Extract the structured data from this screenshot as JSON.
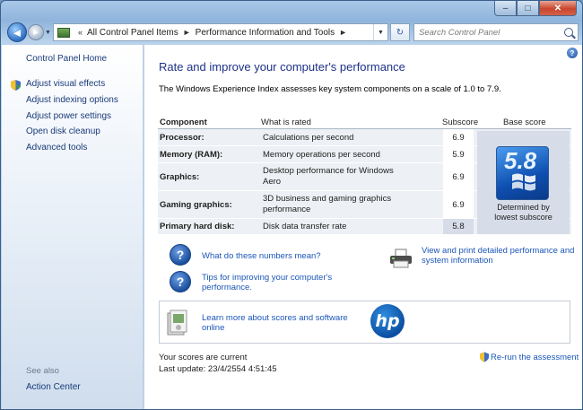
{
  "window": {
    "caption_buttons": [
      "–",
      "□",
      "✕"
    ]
  },
  "nav": {
    "back_glyph": "◄",
    "forward_glyph": "►",
    "breadcrumb": [
      "All Control Panel Items",
      "Performance Information and Tools"
    ],
    "search_placeholder": "Search Control Panel",
    "refresh_glyph": "↻"
  },
  "sidebar": {
    "home": "Control Panel Home",
    "items": [
      {
        "label": "Adjust visual effects",
        "shield": true
      },
      {
        "label": "Adjust indexing options",
        "shield": false
      },
      {
        "label": "Adjust power settings",
        "shield": false
      },
      {
        "label": "Open disk cleanup",
        "shield": false
      },
      {
        "label": "Advanced tools",
        "shield": false
      }
    ],
    "see_also_title": "See also",
    "see_also": [
      "Action Center"
    ]
  },
  "main": {
    "help_glyph": "?",
    "title": "Rate and improve your computer's performance",
    "intro": "The Windows Experience Index assesses key system components on a scale of 1.0 to 7.9.",
    "table": {
      "headers": {
        "component": "Component",
        "rated": "What is rated",
        "subscore": "Subscore",
        "base": "Base score"
      },
      "rows": [
        {
          "component": "Processor:",
          "rated": "Calculations per second",
          "subscore": "6.9"
        },
        {
          "component": "Memory (RAM):",
          "rated": "Memory operations per second",
          "subscore": "5.9"
        },
        {
          "component": "Graphics:",
          "rated": "Desktop performance for Windows Aero",
          "subscore": "6.9"
        },
        {
          "component": "Gaming graphics:",
          "rated": "3D business and gaming graphics performance",
          "subscore": "6.9"
        },
        {
          "component": "Primary hard disk:",
          "rated": "Disk data transfer rate",
          "subscore": "5.8"
        }
      ],
      "base_score": "5.8",
      "base_caption_1": "Determined by",
      "base_caption_2": "lowest subscore"
    },
    "links": {
      "numbers_meaning": "What do these numbers mean?",
      "tips_line1": "Tips for improving your computer's",
      "tips_line2": "performance.",
      "print_line1": "View and print detailed performance and",
      "print_line2": "system information",
      "learn_line1": "Learn more about scores and software",
      "learn_line2": "online",
      "rerun": "Re-run the assessment"
    },
    "hp_logo_text": "hp",
    "status": "Your scores are current",
    "last_update": "Last update: 23/4/2554 4:51:45"
  },
  "colors": {
    "link": "#1a56b8",
    "title": "#1e3287",
    "sidebar_link": "#1a3b79",
    "table_row_bg": "#edf0f4",
    "base_panel_bg": "#d6dde8"
  }
}
